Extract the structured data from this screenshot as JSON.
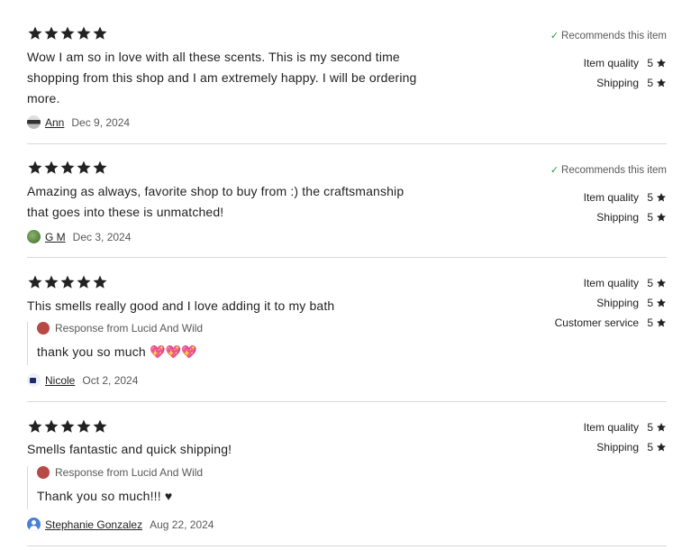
{
  "labels": {
    "recommends": "Recommends this item",
    "item_quality": "Item quality",
    "shipping": "Shipping",
    "customer_service": "Customer service"
  },
  "colors": {
    "star": "#222222",
    "check": "#2b9a3f",
    "divider": "#d8d8d8"
  },
  "reviews": [
    {
      "stars": 5,
      "text": "Wow I am so in love with all these scents. This is my second time shopping from this shop and I am extremely happy. I will be ordering more.",
      "author": "Ann",
      "date": "Dec 9, 2024",
      "recommends": true,
      "ratings": {
        "item_quality": "5",
        "shipping": "5"
      }
    },
    {
      "stars": 5,
      "text": "Amazing as always, favorite shop to buy from :) the craftsmanship that goes into these is unmatched!",
      "author": "G M",
      "date": "Dec 3, 2024",
      "recommends": true,
      "ratings": {
        "item_quality": "5",
        "shipping": "5"
      }
    },
    {
      "stars": 5,
      "text": "This smells really good and I love adding it to my bath",
      "response_from": "Response from Lucid And Wild",
      "response_text": "thank you so much 💖💖💖",
      "author": "Nicole",
      "date": "Oct 2, 2024",
      "ratings": {
        "item_quality": "5",
        "shipping": "5",
        "customer_service": "5"
      }
    },
    {
      "stars": 5,
      "text": "Smells fantastic and quick shipping!",
      "response_from": "Response from Lucid And Wild",
      "response_text": "Thank you so much!!! ♥",
      "author": "Stephanie Gonzalez",
      "date": "Aug 22, 2024",
      "ratings": {
        "item_quality": "5",
        "shipping": "5"
      }
    }
  ]
}
